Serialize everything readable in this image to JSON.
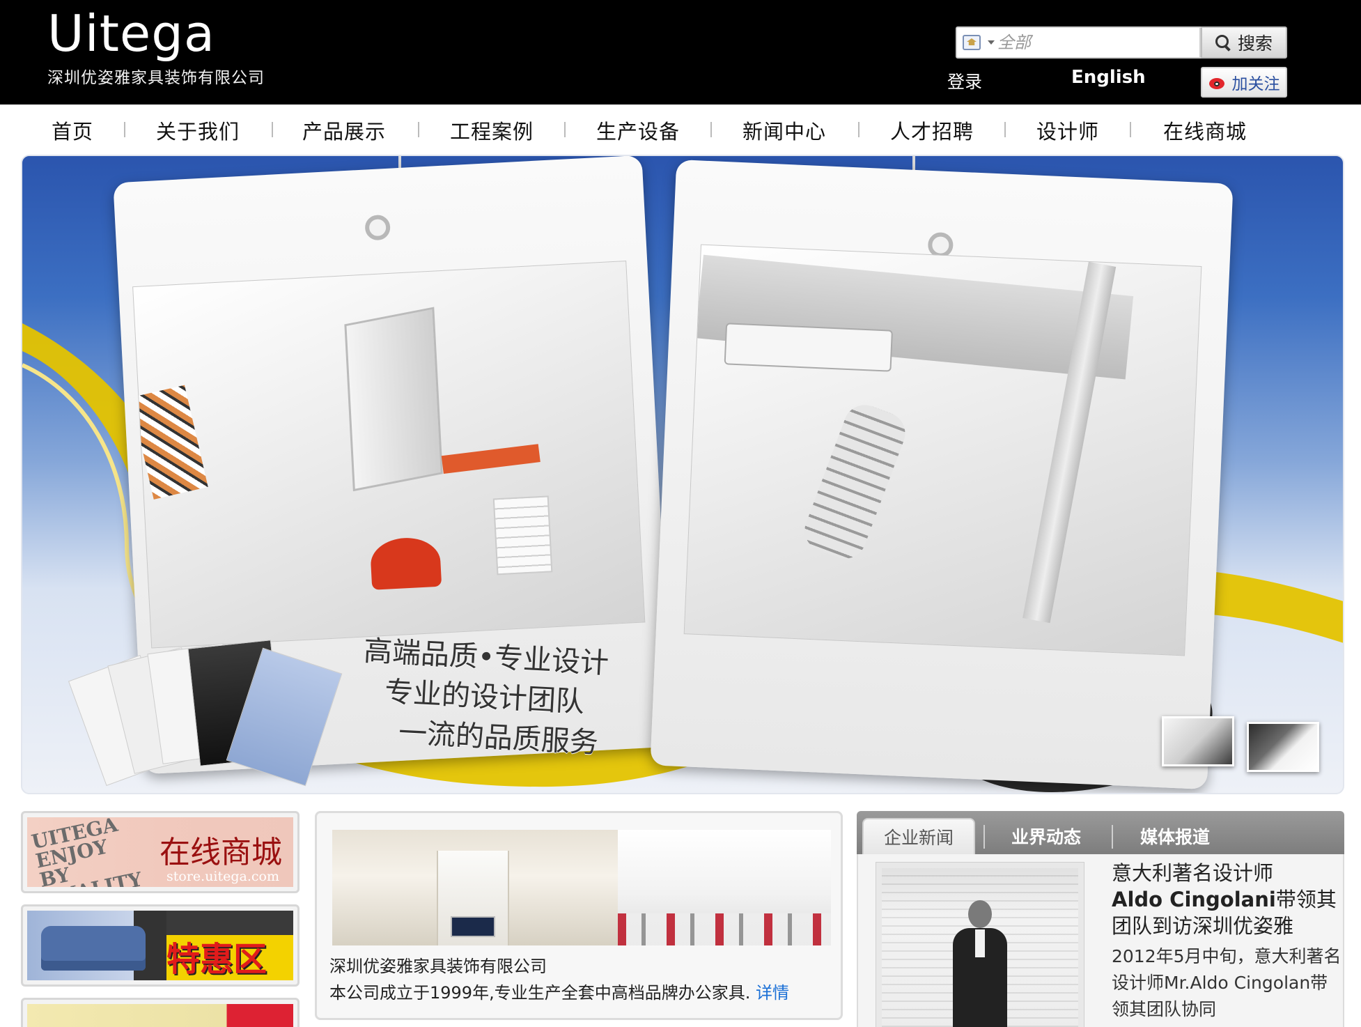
{
  "header": {
    "logo_brand": "Uitega",
    "logo_company": "深圳优姿雅家具装饰有限公司",
    "search": {
      "scope_icon": "house-icon",
      "placeholder": "全部",
      "button_label": "搜索",
      "button_icon": "search-icon"
    },
    "login_label": "登录",
    "english_label": "English",
    "follow_label": "加关注",
    "follow_icon": "weibo-icon"
  },
  "nav": {
    "items": [
      "首页",
      "关于我们",
      "产品展示",
      "工程案例",
      "生产设备",
      "新闻中心",
      "人才招聘",
      "设计师",
      "在线商城"
    ]
  },
  "banner": {
    "slogan": [
      "高端品质•专业设计",
      "专业的设计团队",
      "一流的品质服务"
    ],
    "colors": {
      "sky_top": "#2b55ae",
      "sky_bottom": "#eef1f7",
      "swoosh": "#e4c300"
    }
  },
  "promos": {
    "store": {
      "brand": "UITEGA ENJOY BY QUALITY",
      "label": "在线商城",
      "url": "store.uitega.com"
    },
    "sale": {
      "label": "特惠区"
    }
  },
  "about": {
    "title": "深圳优姿雅家具装饰有限公司",
    "description": "本公司成立于1999年,专业生产全套中高档品牌办公家具.",
    "more_link": "详情"
  },
  "news": {
    "tabs": [
      "企业新闻",
      "业界动态",
      "媒体报道"
    ],
    "active_tab": 0,
    "headline_1": "意大利著名设计师",
    "headline_name": "Aldo Cingolani",
    "headline_2": "带领其团队到访深圳优姿雅",
    "excerpt": "2012年5月中旬，意大利著名设计师Mr.Aldo Cingolan带领其团队协同"
  }
}
